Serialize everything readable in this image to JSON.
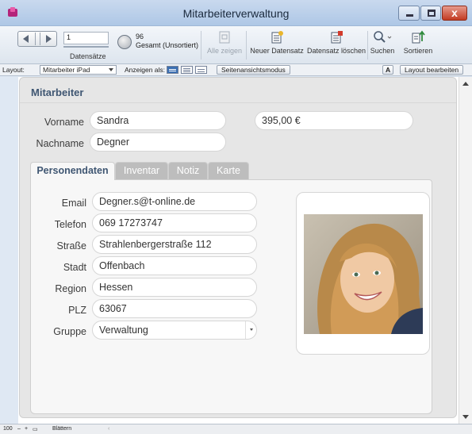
{
  "window": {
    "title": "Mitarbeiterverwaltung",
    "close_glyph": "x"
  },
  "toolbar": {
    "record_number": "1",
    "records_label": "Datensätze",
    "total_count": "96",
    "total_label": "Gesamt (Unsortiert)",
    "show_all": "Alle zeigen",
    "new_record": "Neuer Datensatz",
    "delete_record": "Datensatz löschen",
    "find": "Suchen",
    "sort": "Sortieren"
  },
  "layoutbar": {
    "layout_label": "Layout:",
    "layout_value": "Mitarbeiter iPad",
    "view_as_label": "Anzeigen als:",
    "preview_mode": "Seitenansichtsmodus",
    "format_glyph": "A",
    "edit_layout": "Layout bearbeiten"
  },
  "form": {
    "header": "Mitarbeiter",
    "first_name_label": "Vorname",
    "first_name": "Sandra",
    "last_name_label": "Nachname",
    "last_name": "Degner",
    "amount": "395,00 €",
    "tabs": [
      {
        "label": "Personendaten"
      },
      {
        "label": "Inventar"
      },
      {
        "label": "Notiz"
      },
      {
        "label": "Karte"
      }
    ],
    "fields": {
      "email_label": "Email",
      "email": "Degner.s@t-online.de",
      "phone_label": "Telefon",
      "phone": "069 17273747",
      "street_label": "Straße",
      "street": "Strahlenbergerstraße 112",
      "city_label": "Stadt",
      "city": "Offenbach",
      "region_label": "Region",
      "region": "Hessen",
      "zip_label": "PLZ",
      "zip": "63067",
      "group_label": "Gruppe",
      "group": "Verwaltung"
    }
  },
  "statusbar": {
    "zoom": "100",
    "mode": "Blättern"
  },
  "icons": [
    "app-icon",
    "minimize-icon",
    "maximize-icon",
    "close-icon",
    "record-navigator-icon",
    "pie-chart-icon",
    "show-all-icon",
    "new-record-icon",
    "delete-record-icon",
    "search-icon",
    "sort-icon",
    "form-view-icon",
    "list-view-icon",
    "table-view-icon",
    "chevron-down-icon",
    "photo-portrait"
  ]
}
